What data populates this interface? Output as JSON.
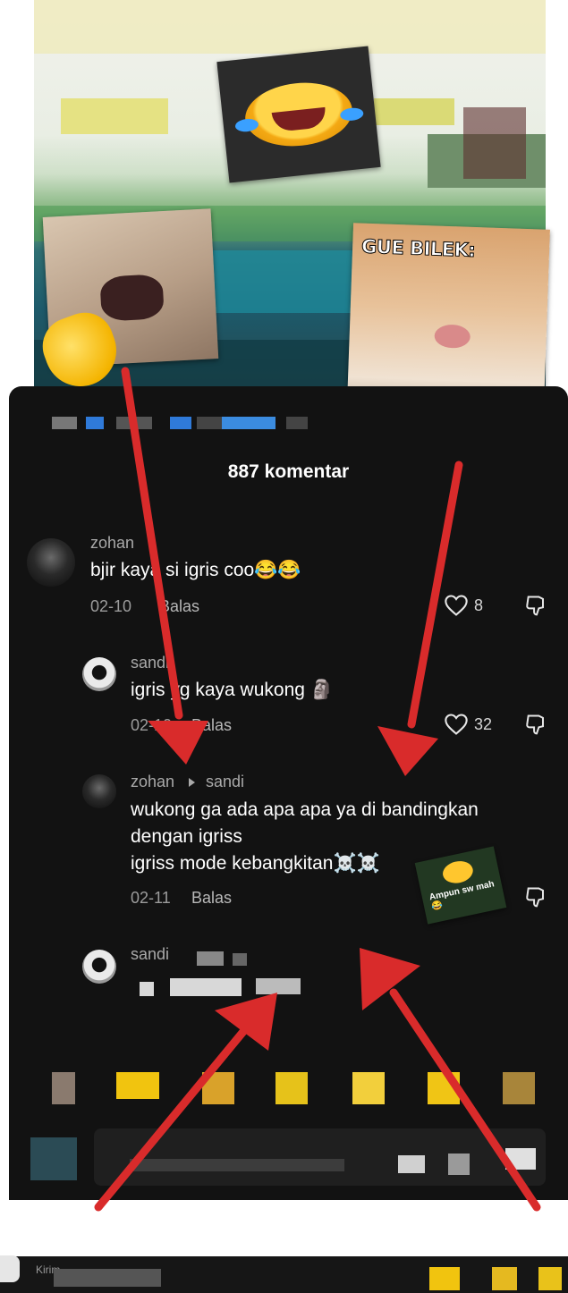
{
  "header": {
    "comment_count": "887 komentar"
  },
  "overlay": {
    "gue_bilek": "GUE BILEK:",
    "ampun_sticker": "Ampun sw mah 😂"
  },
  "comments": [
    {
      "username": "zohan",
      "text": "bjir kaya si igris coo😂😂",
      "date": "02-10",
      "reply_label": "Balas",
      "likes": "8"
    },
    {
      "username": "sandi",
      "text": "igris yg kaya wukong 🗿",
      "date": "02-10",
      "reply_label": "Balas",
      "likes": "32"
    },
    {
      "username": "zohan",
      "reply_to": "sandi",
      "text_line1": "wukong ga ada apa apa ya di bandingkan",
      "text_line2": "dengan igriss",
      "text_line3": "igriss mode kebangkitan☠️☠️",
      "date": "02-11",
      "reply_label": "Balas"
    },
    {
      "username": "sandi"
    }
  ],
  "bottom_bar": {
    "label": "Kirim"
  },
  "colors": {
    "arrow": "#d92b2b",
    "sheet_bg": "#121212",
    "text": "#ffffff",
    "meta": "#9c9c9c"
  }
}
